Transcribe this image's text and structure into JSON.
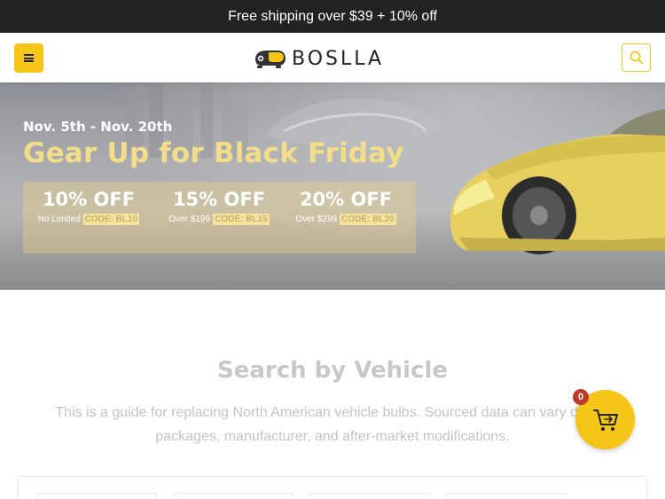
{
  "announcement": {
    "text": "Free shipping over $39 + 10% off"
  },
  "header": {
    "logo_text": "BOSLLA",
    "menu_icon": "hamburger-icon",
    "search_icon": "search-icon"
  },
  "hero": {
    "date": "Nov. 5th - Nov. 20th",
    "title": "Gear Up for Black Friday",
    "offers": [
      {
        "percent": "10% OFF",
        "condition": "No Limited",
        "code": "CODE: BL10"
      },
      {
        "percent": "15% OFF",
        "condition": "Over $199",
        "code": "CODE: BL15"
      },
      {
        "percent": "20% OFF",
        "condition": "Over $299",
        "code": "CODE: BL20"
      }
    ]
  },
  "vehicle_search": {
    "title": "Search by Vehicle",
    "description": "This is a guide for replacing North American vehicle bulbs. Sourced data can vary due to packages, manufacturer, and after-market modifications."
  },
  "cart": {
    "count": "0",
    "icon": "cart-icon"
  },
  "colors": {
    "accent": "#f5c518",
    "topbar": "#222222",
    "badge": "#c0392b"
  }
}
